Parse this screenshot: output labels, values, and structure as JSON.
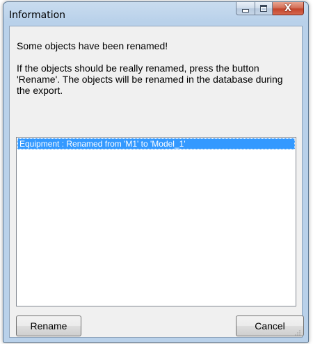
{
  "window": {
    "title": "Information"
  },
  "title_controls": {
    "close_glyph": "X"
  },
  "message": {
    "line1": "Some objects have been renamed!",
    "line2": "If the objects should be really renamed, press the button 'Rename'. The objects will be renamed in the database during the export."
  },
  "list": {
    "items": [
      {
        "label": "Equipment : Renamed from 'M1' to 'Model_1'",
        "selected": true
      }
    ]
  },
  "buttons": {
    "rename_label": "Rename",
    "cancel_label": "Cancel"
  },
  "colors": {
    "selection": "#3399ff",
    "title_bar": "#b9d1ea",
    "close_button": "#c4462c"
  },
  "icons": [
    "minimize-icon",
    "maximize-icon",
    "close-icon",
    "resize-grip-icon"
  ]
}
